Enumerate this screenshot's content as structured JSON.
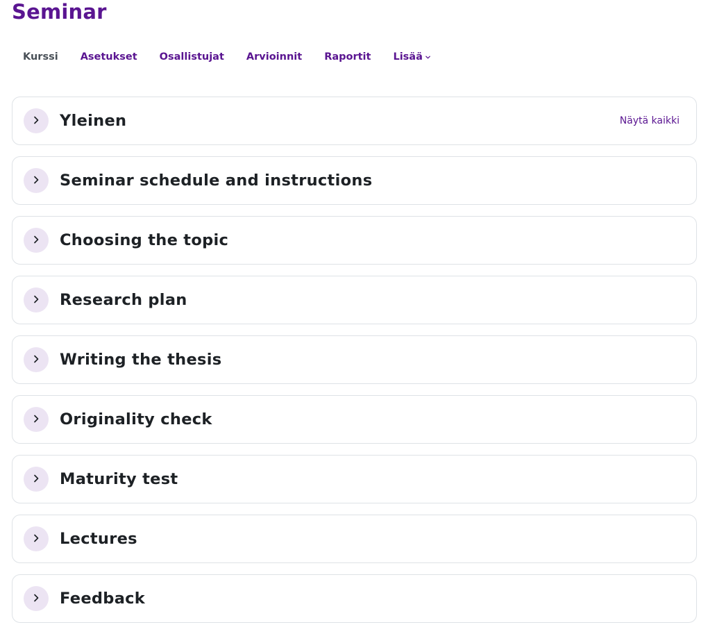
{
  "page": {
    "title": "Seminar"
  },
  "nav": {
    "items": [
      {
        "label": "Kurssi",
        "active": true
      },
      {
        "label": "Asetukset"
      },
      {
        "label": "Osallistujat"
      },
      {
        "label": "Arvioinnit"
      },
      {
        "label": "Raportit"
      },
      {
        "label": "Lisää",
        "dropdown": true
      }
    ]
  },
  "sections": [
    {
      "title": "Yleinen",
      "action": "Näytä kaikki"
    },
    {
      "title": "Seminar schedule and instructions"
    },
    {
      "title": "Choosing the topic"
    },
    {
      "title": "Research plan"
    },
    {
      "title": "Writing the thesis"
    },
    {
      "title": "Originality check"
    },
    {
      "title": "Maturity test"
    },
    {
      "title": "Lectures"
    },
    {
      "title": "Feedback"
    }
  ],
  "icons": {
    "expand": "chevron-right-icon",
    "dropdown": "chevron-down-icon"
  },
  "colors": {
    "brand": "#5a1591",
    "toggle_bg": "#ece4f3",
    "border": "#dee2e6",
    "active_nav": "#495057"
  }
}
